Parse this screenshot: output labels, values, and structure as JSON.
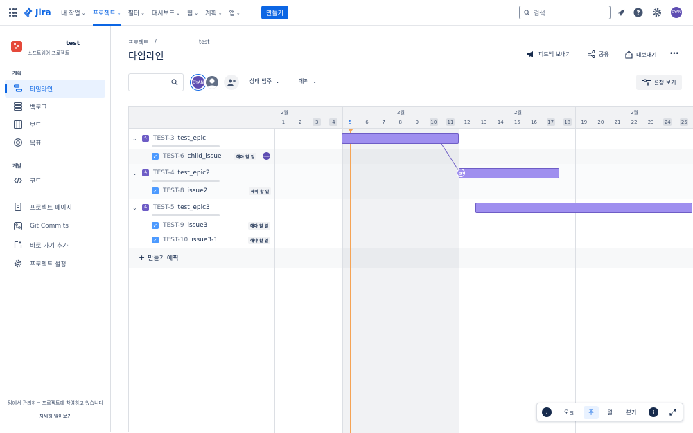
{
  "topbar": {
    "logo": "Jira",
    "nav": [
      {
        "label": "내 작업",
        "active": false
      },
      {
        "label": "프로젝트",
        "active": true
      },
      {
        "label": "필터",
        "active": false
      },
      {
        "label": "대시보드",
        "active": false
      },
      {
        "label": "팀",
        "active": false
      },
      {
        "label": "계획",
        "active": false
      },
      {
        "label": "앱",
        "active": false
      }
    ],
    "create": "만들기",
    "search_placeholder": "검색",
    "avatar": "DYAN"
  },
  "sidebar": {
    "project_name": "test",
    "project_type": "소프트웨어 프로젝트",
    "section_plan": "계획",
    "plan_items": [
      "타임라인",
      "백로그",
      "보드",
      "목표"
    ],
    "section_dev": "개발",
    "dev_items": [
      "코드"
    ],
    "other_items": [
      "프로젝트 페이지",
      "Git Commits",
      "바로 가기 추가",
      "프로젝트 설정"
    ],
    "footer_text": "팀에서 관리하는 프로젝트에 참여하고 있습니다",
    "footer_link": "자세히 알아보기"
  },
  "header": {
    "breadcrumb_root": "프로젝트",
    "breadcrumb_sep": "/",
    "breadcrumb_project": "test",
    "title": "타임라인",
    "feedback": "피드백 보내기",
    "share": "공유",
    "export": "내보내기",
    "more": "•••"
  },
  "filters": {
    "avatar": "DYAN",
    "status_category": "상태 범주",
    "epic": "에픽",
    "view_settings": "설정 보기"
  },
  "timeline": {
    "months": [
      "2월",
      "2월",
      "2월",
      "2월"
    ],
    "days": [
      "1",
      "2",
      "3",
      "4",
      "5",
      "6",
      "7",
      "8",
      "9",
      "10",
      "11",
      "12",
      "13",
      "14",
      "15",
      "16",
      "17",
      "18",
      "19",
      "20",
      "21",
      "22",
      "23",
      "24",
      "25"
    ],
    "weekend_days": [
      "3",
      "4",
      "10",
      "11",
      "17",
      "18",
      "24",
      "25"
    ],
    "today": "5",
    "rows": [
      {
        "type": "epic",
        "key": "TEST-3",
        "summary": "test_epic"
      },
      {
        "type": "task",
        "key": "TEST-6",
        "summary": "child_issue",
        "status": "해야 할 일",
        "assignee": "DYAN"
      },
      {
        "type": "epic",
        "key": "TEST-4",
        "summary": "test_epic2"
      },
      {
        "type": "task",
        "key": "TEST-8",
        "summary": "issue2",
        "status": "해야 할 일"
      },
      {
        "type": "epic",
        "key": "TEST-5",
        "summary": "test_epic3"
      },
      {
        "type": "task",
        "key": "TEST-9",
        "summary": "issue3",
        "status": "해야 할 일"
      },
      {
        "type": "task",
        "key": "TEST-10",
        "summary": "issue3-1",
        "status": "해야 할 일"
      }
    ],
    "create_epic": "만들기 에픽",
    "bars": [
      {
        "epic": "TEST-3",
        "start": "5",
        "end": "11"
      },
      {
        "epic": "TEST-4",
        "start": "12",
        "end": "17"
      },
      {
        "epic": "TEST-5",
        "start": "13",
        "end": "25"
      }
    ]
  },
  "zoom": {
    "today": "오늘",
    "week": "주",
    "month": "월",
    "quarter": "분기",
    "selected": "주"
  }
}
